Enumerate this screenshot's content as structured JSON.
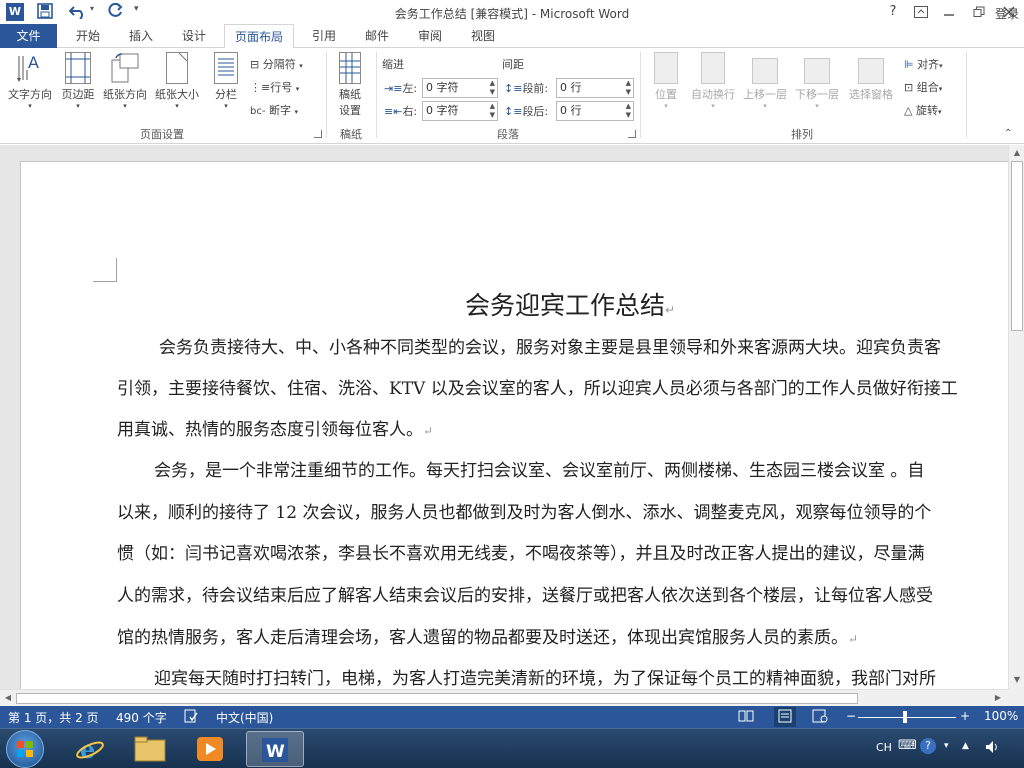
{
  "window": {
    "title": "会务工作总结 [兼容模式] - Microsoft Word",
    "help": "?",
    "signin": "登录",
    "colors": {
      "brand": "#2b579a"
    }
  },
  "quick_access": {
    "icons": [
      "word-logo-icon",
      "save-icon",
      "undo-icon",
      "redo-icon",
      "customize-icon"
    ]
  },
  "tabs": [
    {
      "label": "文件"
    },
    {
      "label": "开始"
    },
    {
      "label": "插入"
    },
    {
      "label": "设计"
    },
    {
      "label": "页面布局"
    },
    {
      "label": "引用"
    },
    {
      "label": "邮件"
    },
    {
      "label": "审阅"
    },
    {
      "label": "视图"
    }
  ],
  "ribbon": {
    "page_setup": {
      "name": "页面设置",
      "text_direction": "文字方向",
      "margins": "页边距",
      "orientation": "纸张方向",
      "size": "纸张大小",
      "columns": "分栏",
      "breaks": "分隔符",
      "line_numbers": "行号",
      "hyphenation": "断字"
    },
    "draft": {
      "name": "稿纸",
      "settings_line1": "稿纸",
      "settings_line2": "设置"
    },
    "paragraph": {
      "name": "段落",
      "indent_label": "缩进",
      "spacing_label": "间距",
      "left_label": "左:",
      "right_label": "右:",
      "before_label": "段前:",
      "after_label": "段后:",
      "left_value": "0 字符",
      "right_value": "0 字符",
      "before_value": "0 行",
      "after_value": "0 行"
    },
    "arrange": {
      "name": "排列",
      "position": "位置",
      "wrap_text": "自动换行",
      "bring_forward": "上移一层",
      "send_backward": "下移一层",
      "selection_pane": "选择窗格",
      "align": "对齐",
      "group": "组合",
      "rotate": "旋转"
    }
  },
  "document": {
    "title": "会务迎宾工作总结",
    "lines": [
      "会务负责接待大、中、小各种不同类型的会议，服务对象主要是县里领导和外来客源两大块。迎宾负责客",
      "引领，主要接待餐饮、住宿、洗浴、KTV 以及会议室的客人，所以迎宾人员必须与各部门的工作人员做好衔接工",
      "用真诚、热情的服务态度引领每位客人。",
      "会务，是一个非常注重细节的工作。每天打扫会议室、会议室前厅、两侧楼梯、生态园三楼会议室 。自",
      "以来，顺利的接待了 12 次会议，服务人员也都做到及时为客人倒水、添水、调整麦克风，观察每位领导的个",
      "惯（如：闫书记喜欢喝浓茶，李县长不喜欢用无线麦，不喝夜茶等），并且及时改正客人提出的建议，尽量满",
      "人的需求，待会议结束后应了解客人结束会议后的安排，送餐厅或把客人依次送到各个楼层，让每位客人感受",
      "馆的热情服务，客人走后清理会场，客人遗留的物品都要及时送还，体现出宾馆服务人员的素质。",
      "迎宾每天随时打扫转门，电梯，为客人打造完美清新的环境，为了保证每个员工的精神面貌，我部门对所"
    ]
  },
  "status": {
    "page": "第 1 页，共 2 页",
    "words": "490 个字",
    "language": "中文(中国)",
    "zoom": "100%",
    "zoom_level": 1.0
  },
  "taskbar": {
    "tray_lang": "CH"
  }
}
